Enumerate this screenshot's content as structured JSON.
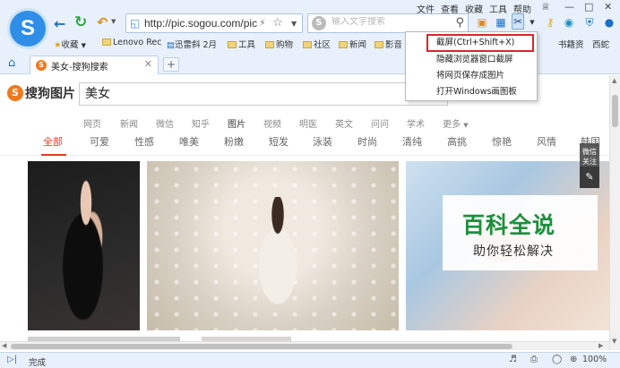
{
  "menu_bar": [
    "文件",
    "查看",
    "收藏",
    "工具",
    "帮助"
  ],
  "address": {
    "url": "http://pic.sogou.com/pic"
  },
  "search_box": {
    "placeholder": "输入文字搜索"
  },
  "favorites": [
    {
      "label": "收藏",
      "type": "star"
    },
    {
      "label": "Lenovo Rec",
      "type": "folder"
    },
    {
      "label": "迅雷斜 2月",
      "type": "page"
    },
    {
      "label": "工具",
      "type": "folder"
    },
    {
      "label": "购物",
      "type": "folder"
    },
    {
      "label": "社区",
      "type": "folder"
    },
    {
      "label": "新闻",
      "type": "folder"
    },
    {
      "label": "影音",
      "type": "folder"
    },
    {
      "label": "书籍资",
      "type": "text"
    },
    {
      "label": "西蛇",
      "type": "text"
    }
  ],
  "tab": {
    "title": "美女-搜狗搜索"
  },
  "dropdown": {
    "items": [
      {
        "label": "截屏(Ctrl+Shift+X)",
        "highlighted": true
      },
      {
        "label": "隐藏浏览器窗口截屏",
        "highlighted": false
      },
      {
        "label": "将网页保存成图片",
        "highlighted": false
      },
      {
        "label": "打开Windows画图板",
        "highlighted": false
      }
    ],
    "highlight_color": "#d9262c"
  },
  "page": {
    "brand": "搜狗图片",
    "query": "美女",
    "vertical_tabs": [
      "网页",
      "新闻",
      "微信",
      "知乎",
      "图片",
      "视频",
      "明医",
      "英文",
      "问问",
      "学术",
      "更多"
    ],
    "active_vertical_tab": "图片",
    "category_tabs": [
      "全部",
      "可爱",
      "性感",
      "唯美",
      "粉嫩",
      "短发",
      "泳装",
      "时尚",
      "清纯",
      "高挑",
      "惊艳",
      "风情",
      "韩国"
    ],
    "active_category_tab": "全部",
    "accent_color": "#e63c1e",
    "side_button": "微信关注"
  },
  "watermark": {
    "title": "百科全说",
    "subtitle": "助你轻松解决"
  },
  "status": {
    "text": "完成",
    "zoom": "100%"
  }
}
